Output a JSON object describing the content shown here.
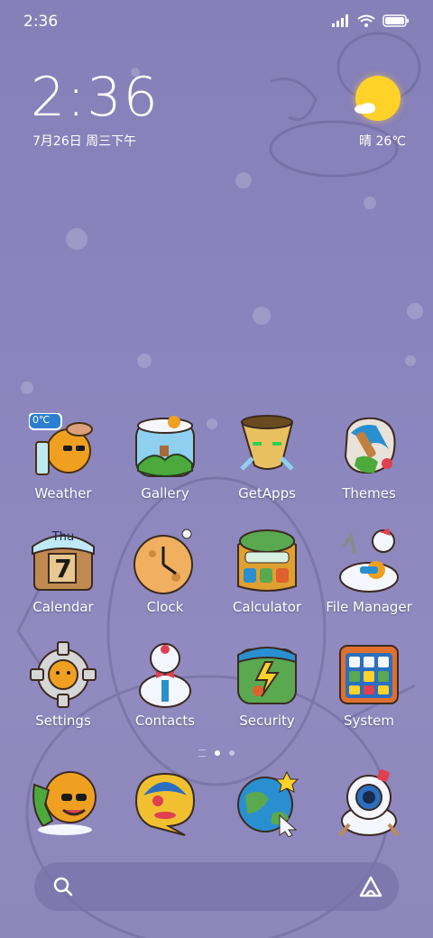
{
  "status_bar": {
    "time": "2:36"
  },
  "clock_widget": {
    "time": "2:36",
    "date": "7月26日 周三下午"
  },
  "weather_widget": {
    "text": "晴 26℃"
  },
  "apps": [
    {
      "label": "Weather",
      "icon": "weather-icon",
      "badge": "0℃"
    },
    {
      "label": "Gallery",
      "icon": "gallery-icon"
    },
    {
      "label": "GetApps",
      "icon": "getapps-icon"
    },
    {
      "label": "Themes",
      "icon": "themes-icon"
    },
    {
      "label": "Calendar",
      "icon": "calendar-icon",
      "day": "Thu",
      "date": "7"
    },
    {
      "label": "Clock",
      "icon": "clock-icon"
    },
    {
      "label": "Calculator",
      "icon": "calculator-icon"
    },
    {
      "label": "File Manager",
      "icon": "file-manager-icon"
    },
    {
      "label": "Settings",
      "icon": "settings-icon"
    },
    {
      "label": "Contacts",
      "icon": "contacts-icon"
    },
    {
      "label": "Security",
      "icon": "security-icon"
    },
    {
      "label": "System",
      "icon": "system-icon"
    }
  ],
  "page_indicator": {
    "pages": 2,
    "active": 1
  },
  "dock": [
    {
      "icon": "phone-icon"
    },
    {
      "icon": "messages-icon"
    },
    {
      "icon": "browser-icon"
    },
    {
      "icon": "camera-icon"
    }
  ],
  "colors": {
    "background": "#8a84bb",
    "accent_sun": "#ffd22a"
  }
}
